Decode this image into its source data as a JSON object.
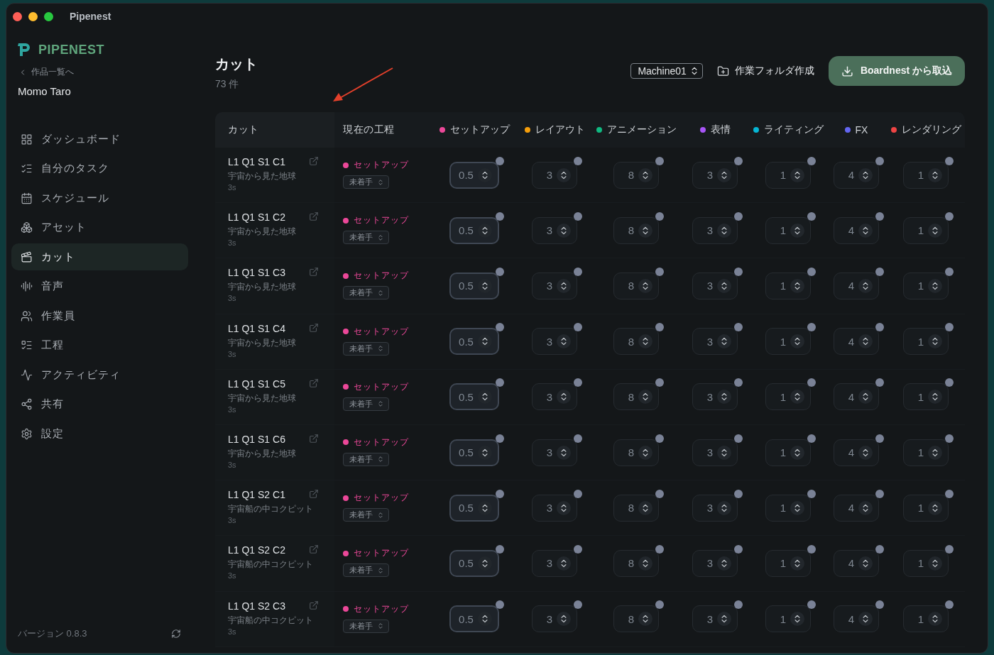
{
  "window": {
    "title": "Pipenest"
  },
  "sidebar": {
    "logo": "PIPENEST",
    "back_link": "作品一覧へ",
    "project": "Momo Taro",
    "items": [
      {
        "label": "ダッシュボード",
        "selected": false
      },
      {
        "label": "自分のタスク",
        "selected": false
      },
      {
        "label": "スケジュール",
        "selected": false
      },
      {
        "label": "アセット",
        "selected": false
      },
      {
        "label": "カット",
        "selected": true
      },
      {
        "label": "音声",
        "selected": false
      },
      {
        "label": "作業員",
        "selected": false
      },
      {
        "label": "工程",
        "selected": false
      },
      {
        "label": "アクティビティ",
        "selected": false
      },
      {
        "label": "共有",
        "selected": false
      },
      {
        "label": "設定",
        "selected": false
      }
    ],
    "version": "バージョン 0.8.3"
  },
  "header": {
    "title": "カット",
    "count": "73 件",
    "machine_select": "Machine01",
    "folder_button": "作業フォルダ作成",
    "import_button": "Boardnest から取込"
  },
  "table": {
    "columns": [
      {
        "label": "カット"
      },
      {
        "label": "現在の工程"
      }
    ],
    "stages": [
      {
        "label": "セットアップ",
        "color": "#ec4899",
        "active": true
      },
      {
        "label": "レイアウト",
        "color": "#f59e0b",
        "active": false
      },
      {
        "label": "アニメーション",
        "color": "#10b981",
        "active": false
      },
      {
        "label": "表情",
        "color": "#a855f7",
        "active": false
      },
      {
        "label": "ライティング",
        "color": "#06b6d4",
        "active": false
      },
      {
        "label": "FX",
        "color": "#6366f1",
        "active": false
      },
      {
        "label": "レンダリング",
        "color": "#ef4444",
        "active": false
      }
    ],
    "rows": [
      {
        "name": "L1 Q1 S1 C1",
        "description": "宇宙から見た地球",
        "duration": "3s",
        "stage": {
          "label": "セットアップ",
          "color": "#ec4899"
        },
        "status": "未着手",
        "values": [
          "0.5",
          "3",
          "8",
          "3",
          "1",
          "4",
          "1"
        ]
      },
      {
        "name": "L1 Q1 S1 C2",
        "description": "宇宙から見た地球",
        "duration": "3s",
        "stage": {
          "label": "セットアップ",
          "color": "#ec4899"
        },
        "status": "未着手",
        "values": [
          "0.5",
          "3",
          "8",
          "3",
          "1",
          "4",
          "1"
        ]
      },
      {
        "name": "L1 Q1 S1 C3",
        "description": "宇宙から見た地球",
        "duration": "3s",
        "stage": {
          "label": "セットアップ",
          "color": "#ec4899"
        },
        "status": "未着手",
        "values": [
          "0.5",
          "3",
          "8",
          "3",
          "1",
          "4",
          "1"
        ]
      },
      {
        "name": "L1 Q1 S1 C4",
        "description": "宇宙から見た地球",
        "duration": "3s",
        "stage": {
          "label": "セットアップ",
          "color": "#ec4899"
        },
        "status": "未着手",
        "values": [
          "0.5",
          "3",
          "8",
          "3",
          "1",
          "4",
          "1"
        ]
      },
      {
        "name": "L1 Q1 S1 C5",
        "description": "宇宙から見た地球",
        "duration": "3s",
        "stage": {
          "label": "セットアップ",
          "color": "#ec4899"
        },
        "status": "未着手",
        "values": [
          "0.5",
          "3",
          "8",
          "3",
          "1",
          "4",
          "1"
        ]
      },
      {
        "name": "L1 Q1 S1 C6",
        "description": "宇宙から見た地球",
        "duration": "3s",
        "stage": {
          "label": "セットアップ",
          "color": "#ec4899"
        },
        "status": "未着手",
        "values": [
          "0.5",
          "3",
          "8",
          "3",
          "1",
          "4",
          "1"
        ]
      },
      {
        "name": "L1 Q1 S2 C1",
        "description": "宇宙船の中コクピット",
        "duration": "3s",
        "stage": {
          "label": "セットアップ",
          "color": "#ec4899"
        },
        "status": "未着手",
        "values": [
          "0.5",
          "3",
          "8",
          "3",
          "1",
          "4",
          "1"
        ]
      },
      {
        "name": "L1 Q1 S2 C2",
        "description": "宇宙船の中コクピット",
        "duration": "3s",
        "stage": {
          "label": "セットアップ",
          "color": "#ec4899"
        },
        "status": "未着手",
        "values": [
          "0.5",
          "3",
          "8",
          "3",
          "1",
          "4",
          "1"
        ]
      },
      {
        "name": "L1 Q1 S2 C3",
        "description": "宇宙船の中コクピット",
        "duration": "3s",
        "stage": {
          "label": "セットアップ",
          "color": "#ec4899"
        },
        "status": "未着手",
        "values": [
          "0.5",
          "3",
          "8",
          "3",
          "1",
          "4",
          "1"
        ]
      }
    ]
  }
}
